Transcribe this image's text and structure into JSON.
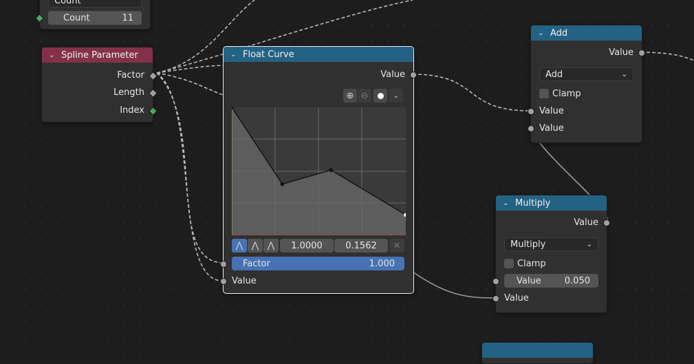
{
  "top_node": {
    "dropdown_value": "Count",
    "count_label": "Count",
    "count_value": "11"
  },
  "spline_parameter": {
    "title": "Spline Parameter",
    "outputs": [
      "Factor",
      "Length",
      "Index"
    ]
  },
  "float_curve": {
    "title": "Float Curve",
    "output_label": "Value",
    "point_x": "1.0000",
    "point_y": "0.1562",
    "factor_label": "Factor",
    "factor_value": "1.000",
    "input_value_label": "Value",
    "curve_points": [
      [
        0,
        1
      ],
      [
        0.29,
        0.4
      ],
      [
        0.57,
        0.51
      ],
      [
        1,
        0.16
      ]
    ]
  },
  "add_node": {
    "title": "Add",
    "output_label": "Value",
    "operation": "Add",
    "clamp_label": "Clamp",
    "input1_label": "Value",
    "input2_label": "Value"
  },
  "multiply_node": {
    "title": "Multiply",
    "output_label": "Value",
    "operation": "Multiply",
    "clamp_label": "Clamp",
    "value_label": "Value",
    "value_value": "0.050",
    "input2_label": "Value"
  },
  "colors": {
    "header_blue": "#246283",
    "header_red": "#83314a",
    "factor_bar": "#4772b3"
  }
}
